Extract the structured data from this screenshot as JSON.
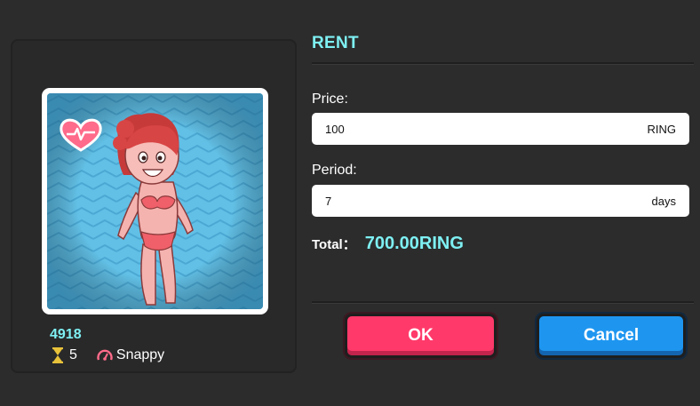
{
  "card": {
    "token_id": "4918",
    "generation": "5",
    "speed": "Snappy"
  },
  "rent": {
    "title": "RENT",
    "price_label": "Price:",
    "price_value": "100",
    "price_unit": "RING",
    "period_label": "Period:",
    "period_value": "7",
    "period_unit": "days",
    "total_label": "Total：",
    "total_value": "700.00RING"
  },
  "buttons": {
    "ok_label": "OK",
    "cancel_label": "Cancel"
  },
  "icons": {
    "heart": "heart-pulse-icon",
    "generation": "hourglass-icon",
    "speed": "speedometer-icon"
  },
  "colors": {
    "accent": "#7ef0f3",
    "ok": "#ff3a6a",
    "cancel": "#1e96f0",
    "heart": "#ff6b8a"
  }
}
